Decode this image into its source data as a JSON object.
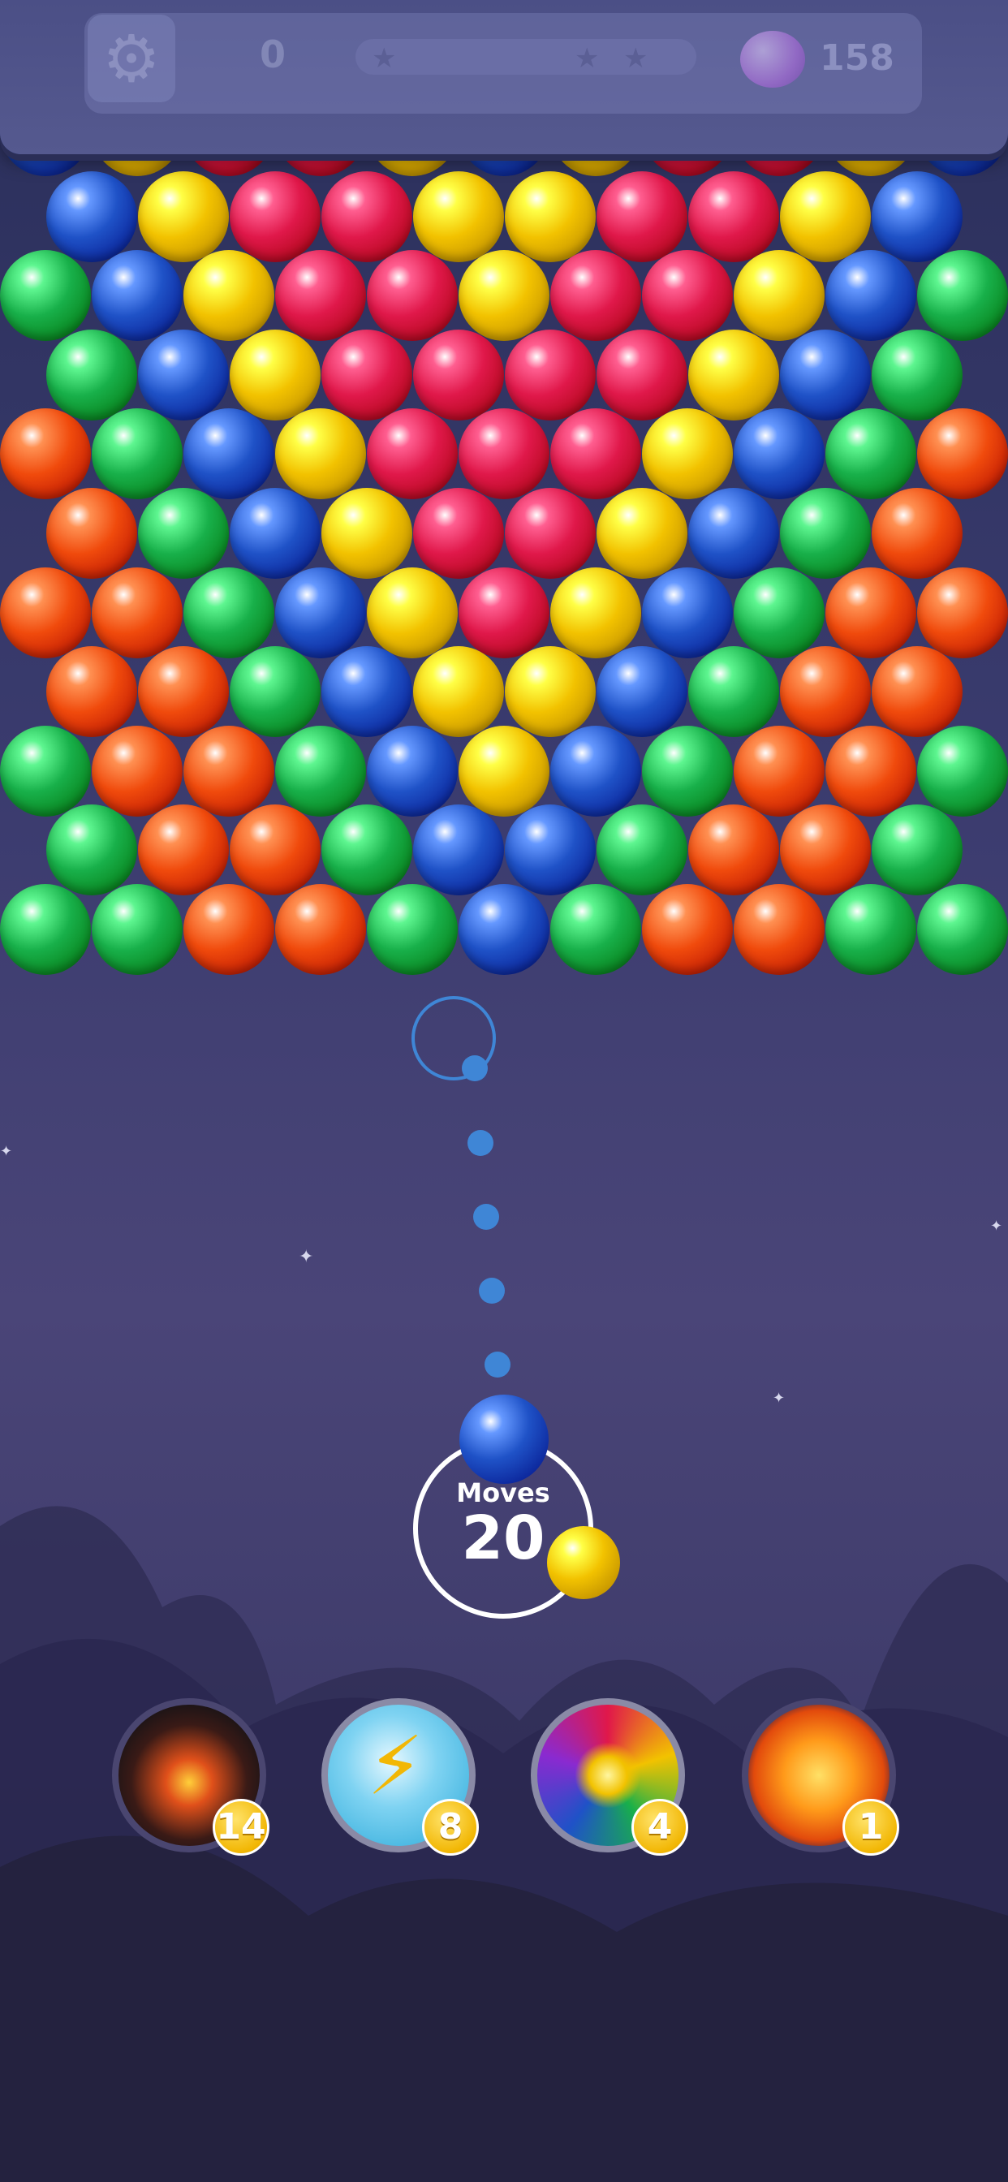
{
  "hud": {
    "settings_icon": "gear-icon",
    "score": "0",
    "progress_stars": 3,
    "progress_fraction": 0.0,
    "coins": "158",
    "coins_icon": "heart-gem-icon"
  },
  "board": {
    "colors": {
      "B": "#1f52c7",
      "Y": "#f2c200",
      "R": "#e0184a",
      "G": "#18b04a",
      "O": "#f04a0c"
    },
    "rows": [
      "BYRRYBYRRYB",
      "BYRRYYRRYB",
      "GBYRRYRRYBG",
      "GBYRRRRYBG",
      "OGBYRRRYBGO",
      "OGBYRRYBGO",
      "OOGBYRYBGOO",
      "OOGBYYBGOO",
      "GOOGBYBGOOG",
      "GOOGBBGOOG",
      "GGOOGBGOOGG"
    ]
  },
  "shooter": {
    "current_bubble": "B",
    "next_bubble": "Y",
    "moves_label": "Moves",
    "moves_count": "20"
  },
  "boosters": [
    {
      "name": "bomb-booster",
      "icon": "bomb-icon",
      "count": "14"
    },
    {
      "name": "lightning-booster",
      "icon": "lightning-icon",
      "count": "8"
    },
    {
      "name": "rainbow-booster",
      "icon": "rainbow-ball-icon",
      "count": "4"
    },
    {
      "name": "fireball-booster",
      "icon": "fireball-icon",
      "count": "1"
    }
  ]
}
